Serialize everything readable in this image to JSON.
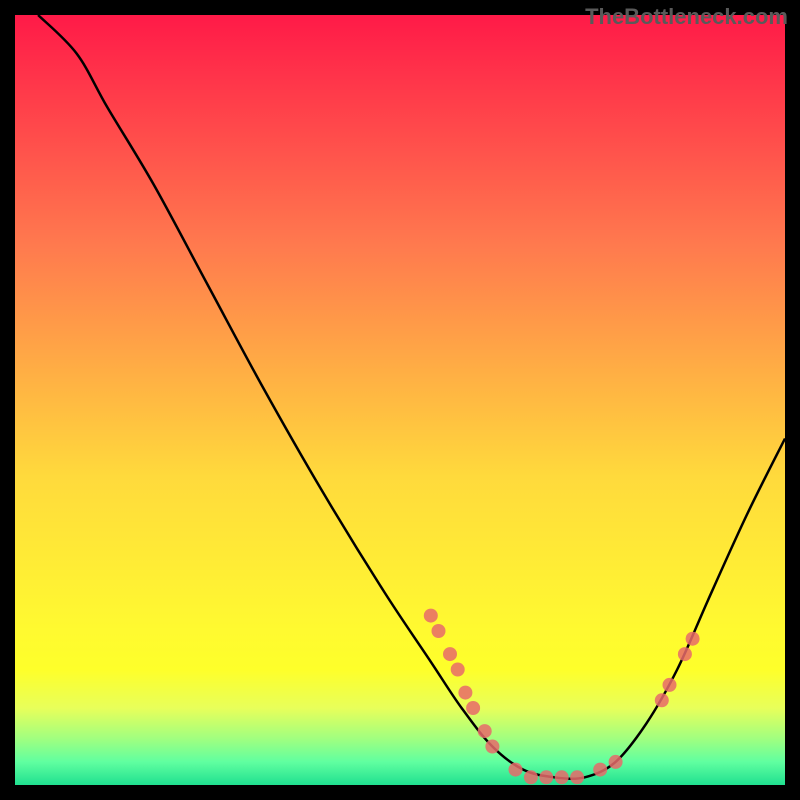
{
  "watermark": "TheBottleneck.com",
  "chart_data": {
    "type": "line",
    "title": "",
    "xlabel": "",
    "ylabel": "",
    "xlim": [
      0,
      100
    ],
    "ylim": [
      0,
      100
    ],
    "curve": [
      {
        "x": 3,
        "y": 100
      },
      {
        "x": 8,
        "y": 95
      },
      {
        "x": 12,
        "y": 88
      },
      {
        "x": 18,
        "y": 78
      },
      {
        "x": 25,
        "y": 65
      },
      {
        "x": 32,
        "y": 52
      },
      {
        "x": 40,
        "y": 38
      },
      {
        "x": 48,
        "y": 25
      },
      {
        "x": 54,
        "y": 16
      },
      {
        "x": 58,
        "y": 10
      },
      {
        "x": 62,
        "y": 5
      },
      {
        "x": 66,
        "y": 2
      },
      {
        "x": 70,
        "y": 1
      },
      {
        "x": 74,
        "y": 1
      },
      {
        "x": 78,
        "y": 3
      },
      {
        "x": 82,
        "y": 8
      },
      {
        "x": 86,
        "y": 15
      },
      {
        "x": 90,
        "y": 24
      },
      {
        "x": 95,
        "y": 35
      },
      {
        "x": 100,
        "y": 45
      }
    ],
    "markers": [
      {
        "x": 54,
        "y": 22
      },
      {
        "x": 55,
        "y": 20
      },
      {
        "x": 56.5,
        "y": 17
      },
      {
        "x": 57.5,
        "y": 15
      },
      {
        "x": 58.5,
        "y": 12
      },
      {
        "x": 59.5,
        "y": 10
      },
      {
        "x": 61,
        "y": 7
      },
      {
        "x": 62,
        "y": 5
      },
      {
        "x": 65,
        "y": 2
      },
      {
        "x": 67,
        "y": 1
      },
      {
        "x": 69,
        "y": 1
      },
      {
        "x": 71,
        "y": 1
      },
      {
        "x": 73,
        "y": 1
      },
      {
        "x": 76,
        "y": 2
      },
      {
        "x": 78,
        "y": 3
      },
      {
        "x": 84,
        "y": 11
      },
      {
        "x": 85,
        "y": 13
      },
      {
        "x": 87,
        "y": 17
      },
      {
        "x": 88,
        "y": 19
      }
    ],
    "gradient_stops": [
      {
        "pos": 0,
        "color": "#ff1a48"
      },
      {
        "pos": 50,
        "color": "#ffda3c"
      },
      {
        "pos": 100,
        "color": "#20e090"
      }
    ],
    "marker_color": "#e86a6a",
    "line_color": "#000000"
  }
}
